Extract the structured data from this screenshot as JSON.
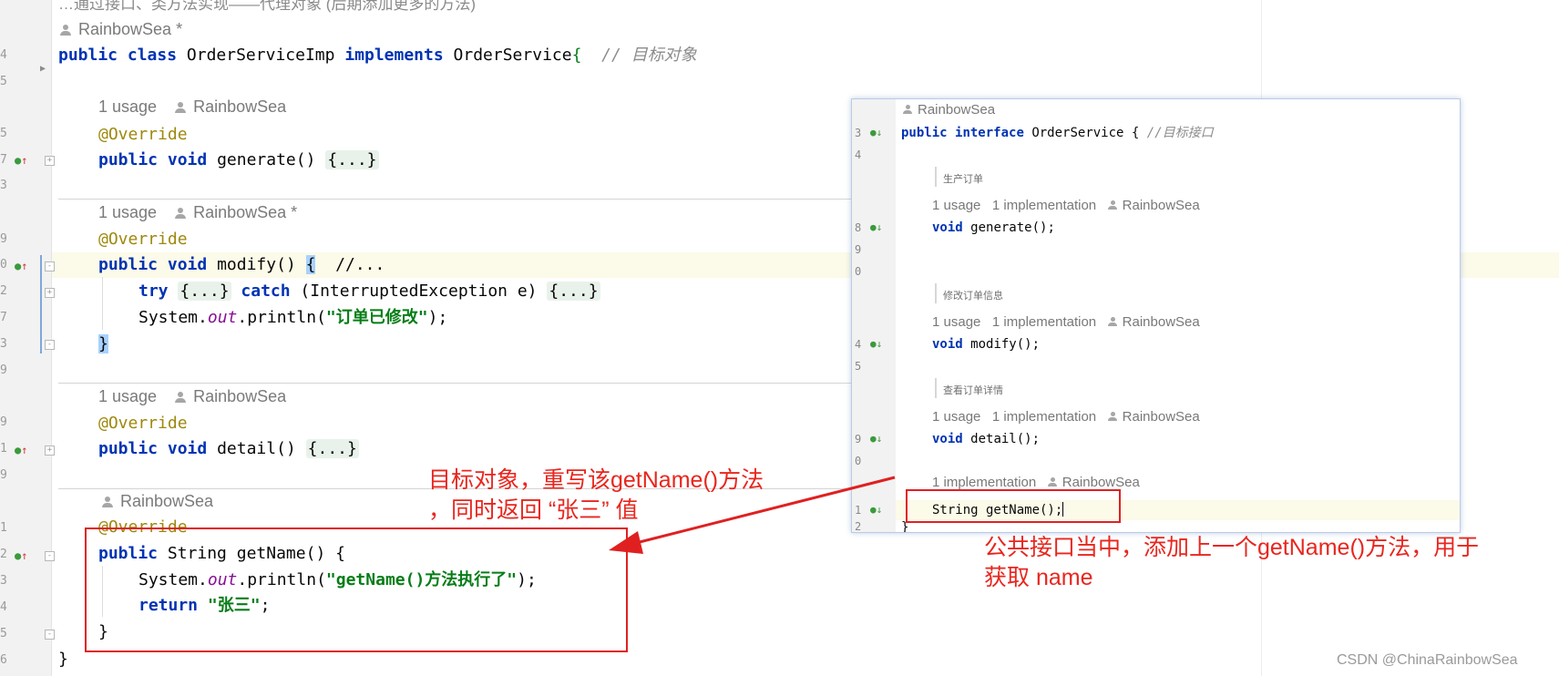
{
  "editor": {
    "top_line_fragment": "…通过接口、类方法实现——代理对象 (后期添加更多的方法)",
    "author_star": "RainbowSea *",
    "author": "RainbowSea",
    "class_decl": {
      "kw_public": "public",
      "kw_class": "class",
      "name": "OrderServiceImp",
      "kw_implements": "implements",
      "iface": "OrderService",
      "brace": "{",
      "comment": "// 目标对象"
    },
    "usage_1": "1 usage",
    "override": "@Override",
    "kw_public": "public",
    "kw_void": "void",
    "m_generate": "generate",
    "m_modify": "modify",
    "m_detail": "detail",
    "m_getname": "getName",
    "parens": "()",
    "folded": "{...}",
    "open_brace": "{",
    "close_brace": "}",
    "modify_comment": "//...",
    "kw_try": "try",
    "kw_catch": "catch",
    "exception": "(InterruptedException e)",
    "system": "System.",
    "out": "out",
    "println": ".println(",
    "str_modified": "\"订单已修改\"",
    "str_getname": "\"getName()方法执行了\"",
    "close_call": ");",
    "kw_return": "return",
    "str_zhangsan": "\"张三\"",
    "semicolon": ";",
    "type_string": "String",
    "gutter_numbers": [
      "4",
      "5",
      "5",
      "7",
      "3",
      "9",
      "0",
      "2",
      "7",
      "3",
      "9",
      "9",
      "1",
      "9",
      "1",
      "2",
      "3",
      "4",
      "5",
      "6"
    ]
  },
  "popup": {
    "author": "RainbowSea",
    "decl_public": "public",
    "decl_interface": "interface",
    "decl_name": "OrderService",
    "decl_brace": "{",
    "decl_comment": "//目标接口",
    "doc_generate": "生产订单",
    "doc_modify": "修改订单信息",
    "doc_detail": "查看订单详情",
    "usage": "1 usage",
    "impl": "1 implementation",
    "kw_void": "void",
    "generate_call": "generate();",
    "modify_call": "modify();",
    "detail_call": "detail();",
    "getname_sig": "String getName();",
    "close_brace": "}",
    "line_numbers": [
      "3",
      "4",
      "8",
      "9",
      "0",
      "4",
      "5",
      "9",
      "0",
      "1",
      "2"
    ]
  },
  "annotations": {
    "note_impl_line1": "目标对象，重写该getName()方法",
    "note_impl_line2": "，同时返回 “张三” 值",
    "note_iface_line1": "公共接口当中，添加上一个getName()方法，用于",
    "note_iface_line2": "获取 name",
    "arrow_color": "#e02020"
  },
  "watermark": "CSDN @ChinaRainbowSea"
}
